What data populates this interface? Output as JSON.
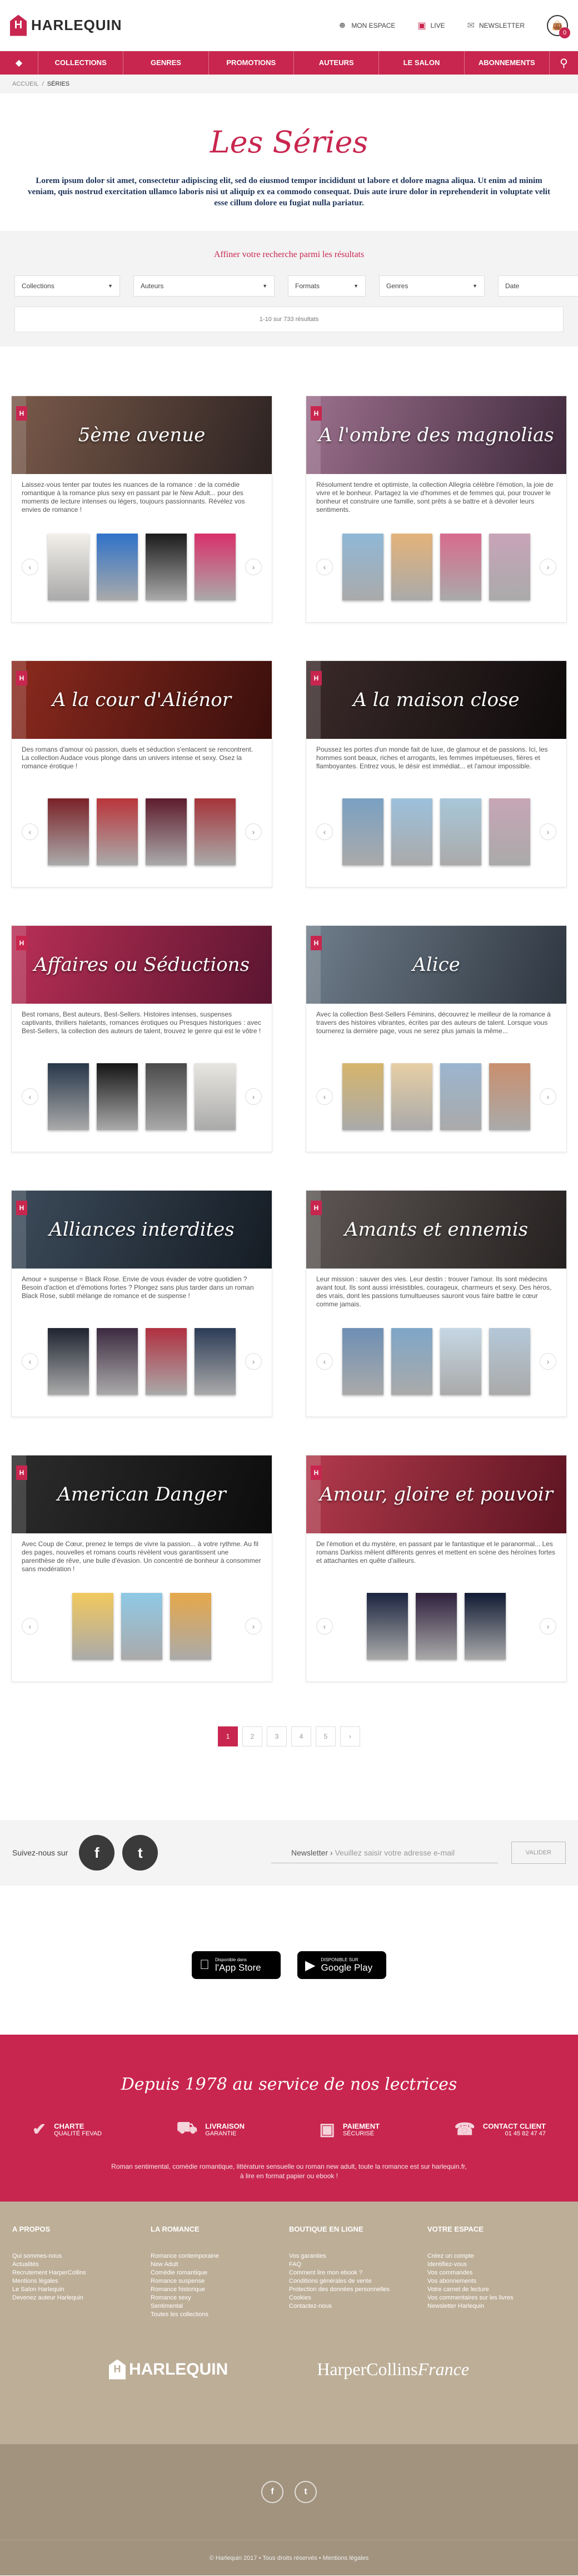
{
  "brand": {
    "logo_letter": "H",
    "logo_text": "HARLEQUIN"
  },
  "header": {
    "links": [
      {
        "label": "MON ESPACE",
        "icon": "user-icon"
      },
      {
        "label": "LIVE",
        "icon": "live-icon"
      },
      {
        "label": "NEWSLETTER",
        "icon": "mail-icon"
      }
    ],
    "cart_count": "0"
  },
  "nav": {
    "items": [
      "COLLECTIONS",
      "GENRES",
      "PROMOTIONS",
      "AUTEURS",
      "LE SALON",
      "ABONNEMENTS"
    ]
  },
  "breadcrumb": {
    "home": "ACCUEIL",
    "sep": "/",
    "current": "SÉRIES"
  },
  "hero": {
    "title": "Les Séries",
    "intro": "Lorem ipsum dolor sit amet, consectetur adipiscing elit, sed do eiusmod tempor incididunt ut labore et dolore magna aliqua. Ut enim ad minim veniam, quis nostrud exercitation ullamco laboris nisi ut aliquip ex ea commodo consequat. Duis aute irure dolor in reprehenderit in voluptate velit esse cillum dolore eu fugiat nulla pariatur."
  },
  "filters": {
    "title": "Affiner votre recherche parmi les résultats",
    "selects": [
      "Collections",
      "Auteurs",
      "Formats",
      "Genres",
      "Date"
    ],
    "results": "1-10 sur 733 résultats"
  },
  "series": [
    {
      "title": "5ème avenue",
      "desc": "Laissez-vous tenter par toutes les nuances de la romance : de la comédie romantique à la romance plus sexy en passant par le New Adult... pour des moments de lecture intenses ou légers, toujours passionnants. Révélez vos envies de romance !",
      "colors": [
        "#7a5a4a",
        "#2d2322"
      ],
      "books": [
        "#f3f0ea",
        "#2f72c9",
        "#1b1b1b",
        "#d9306a"
      ]
    },
    {
      "title": "A l'ombre des magnolias",
      "desc": "Résolument tendre et optimiste, la collection Allegria célèbre l'émotion, la joie de vivre et le bonheur. Partagez la vie d'hommes et de femmes qui, pour trouver le bonheur et construire une famille, sont prêts à se battre et à dévoiler leurs sentiments.",
      "colors": [
        "#9b6f8c",
        "#3f2a3c"
      ],
      "books": [
        "#8fb8d6",
        "#e3b37a",
        "#d76b8d",
        "#c8a4b8"
      ]
    },
    {
      "title": "A la cour d'Aliénor",
      "desc": "Des romans d'amour où passion, duels et séduction s'enlacent se rencontrent. La collection Audace vous plonge dans un univers intense et sexy. Osez la romance érotique !",
      "colors": [
        "#8c2a1e",
        "#3a0f0c"
      ],
      "books": [
        "#7a2228",
        "#b9353b",
        "#5e1c2e",
        "#a5343a"
      ]
    },
    {
      "title": "A la maison close",
      "desc": "Poussez les portes d'un monde fait de luxe, de glamour et de passions. Ici, les hommes sont beaux, riches et arrogants, les femmes impétueuses, fières et flamboyantes. Entrez vous, le désir est immédiat... et l'amour impossible.",
      "colors": [
        "#3b2a2a",
        "#0e0b0b"
      ],
      "books": [
        "#7aa0c2",
        "#9cc0dc",
        "#a8c7d9",
        "#c7a5b5"
      ]
    },
    {
      "title": "Affaires ou Séductions",
      "desc": "Best romans, Best auteurs, Best-Sellers. Histoires intenses, suspenses captivants, thrillers haletants, romances érotiques ou Presques historiques : avec Best-Sellers, la collection des auteurs de talent, trouvez le genre qui est le vôtre !",
      "colors": [
        "#b92f56",
        "#5a1530"
      ],
      "books": [
        "#27374a",
        "#151515",
        "#4a4a4a",
        "#e8e6e0"
      ]
    },
    {
      "title": "Alice",
      "desc": "Avec la collection Best-Sellers Féminins, découvrez le meilleur de la romance à travers des histoires vibrantes, écrites par des auteurs de talent. Lorsque vous tournerez la dernière page, vous ne serez plus jamais la même...",
      "colors": [
        "#6f7d8a",
        "#2e3640"
      ],
      "books": [
        "#d6b56c",
        "#e7cfa5",
        "#9bb5cf",
        "#c98f6e"
      ]
    },
    {
      "title": "Alliances interdites",
      "desc": "Amour + suspense = Black Rose. Envie de vous évader de votre quotidien ? Besoin d'action et d'émotions fortes ? Plongez sans plus tarder dans un roman Black Rose, subtil mélange de romance et de suspense !",
      "colors": [
        "#3c4b5a",
        "#151c24"
      ],
      "books": [
        "#1e2430",
        "#3c2a40",
        "#b03040",
        "#2c3c56"
      ]
    },
    {
      "title": "Amants et ennemis",
      "desc": "Leur mission : sauver des vies. Leur destin : trouver l'amour. Ils sont médecins avant tout. Ils sont aussi irrésistibles, courageux, charmeurs et sexy. Des héros, des vrais, dont les passions tumultueuses sauront vous faire battre le cœur comme jamais.",
      "colors": [
        "#5d5654",
        "#252120"
      ],
      "books": [
        "#6d8fb4",
        "#7fa6c7",
        "#c5d7e4",
        "#b4c8d8"
      ]
    },
    {
      "title": "American Danger",
      "desc": "Avec Coup de Cœur, prenez le temps de vivre la passion... à votre rythme. Au fil des pages, nouvelles et romans courts révèlent vous garantissent une parenthèse de rêve, une bulle d'évasion. Un concentré de bonheur à consommer sans modération !",
      "colors": [
        "#2c2c2c",
        "#0c0c0c"
      ],
      "books": [
        "#f2c95e",
        "#8fc9e6",
        "#e6a84a"
      ]
    },
    {
      "title": "Amour, gloire et pouvoir",
      "desc": "De l'émotion et du mystère, en passant par le fantastique et le paranormal... Les romans Darkiss mêlent différents genres et mettent en scène des héroïnes fortes et attachantes en quête d'ailleurs.",
      "colors": [
        "#b23a4c",
        "#5c1421"
      ],
      "books": [
        "#1b2440",
        "#2e1f3c",
        "#101a33"
      ]
    }
  ],
  "pagination": {
    "pages": [
      "1",
      "2",
      "3",
      "4",
      "5",
      "›"
    ],
    "active": "1"
  },
  "follow": {
    "label": "Suivez-nous sur",
    "facebook": "f",
    "twitter": "t"
  },
  "newsletter": {
    "label": "Newsletter",
    "placeholder": "Veuillez saisir votre adresse e-mail",
    "button": "VALIDER"
  },
  "apps": {
    "appstore": {
      "top": "Disponible dans",
      "name": "l'App Store"
    },
    "googleplay": {
      "top": "DISPONIBLE SUR",
      "name": "Google Play"
    }
  },
  "band": {
    "title": "Depuis 1978 au service de nos lectrices",
    "features": [
      {
        "line1": "CHARTE",
        "line2": "QUALITÉ FEVAD"
      },
      {
        "line1": "LIVRAISON",
        "line2": "GARANTIE"
      },
      {
        "line1": "PAIEMENT",
        "line2": "SÉCURISÉ"
      }
    ],
    "contact": {
      "label": "CONTACT CLIENT",
      "phone": "01 45 82 47 47"
    },
    "text_line1": "Roman sentimental, comédie romantique, littérature sensuelle ou roman new adult, toute la romance est sur harlequin.fr,",
    "text_line2": "à lire en format papier ou ebook !"
  },
  "footer": {
    "columns": [
      {
        "title": "A PROPOS",
        "links": [
          "Qui sommes-nous",
          "Actualités",
          "Recrutement HarperCollins",
          "Mentions légales",
          "Le Salon Harlequin",
          "Devenez auteur Harlequin"
        ]
      },
      {
        "title": "LA ROMANCE",
        "links": [
          "Romance contemporaine",
          "New Adult",
          "Comédie romantique",
          "Romance suspense",
          "Romance historique",
          "Romance sexy",
          "Sentimental",
          "Toutes les collections"
        ]
      },
      {
        "title": "BOUTIQUE EN LIGNE",
        "links": [
          "Vos garanties",
          "FAQ",
          "Comment lire mon ebook ?",
          "Conditions générales de vente",
          "Protection des données personnelles",
          "Cookies",
          "Contactez-nous"
        ]
      },
      {
        "title": "VOTRE ESPACE",
        "links": [
          "Créez un compte",
          "Identifiez-vous",
          "Vos commandes",
          "Vos abonnements",
          "Votre carnet de lecture",
          "Vos commentaires sur les livres",
          "Newsletter Harlequin"
        ]
      }
    ],
    "brand_harlequin": "HARLEQUIN",
    "brand_hc_1": "HarperCollins",
    "brand_hc_2": "France",
    "copyright": "© Harlequin 2017 • Tous droits réservés • Mentions légales"
  },
  "theme": {
    "accent": "#c8264f",
    "footer_bg": "#bdae97"
  }
}
